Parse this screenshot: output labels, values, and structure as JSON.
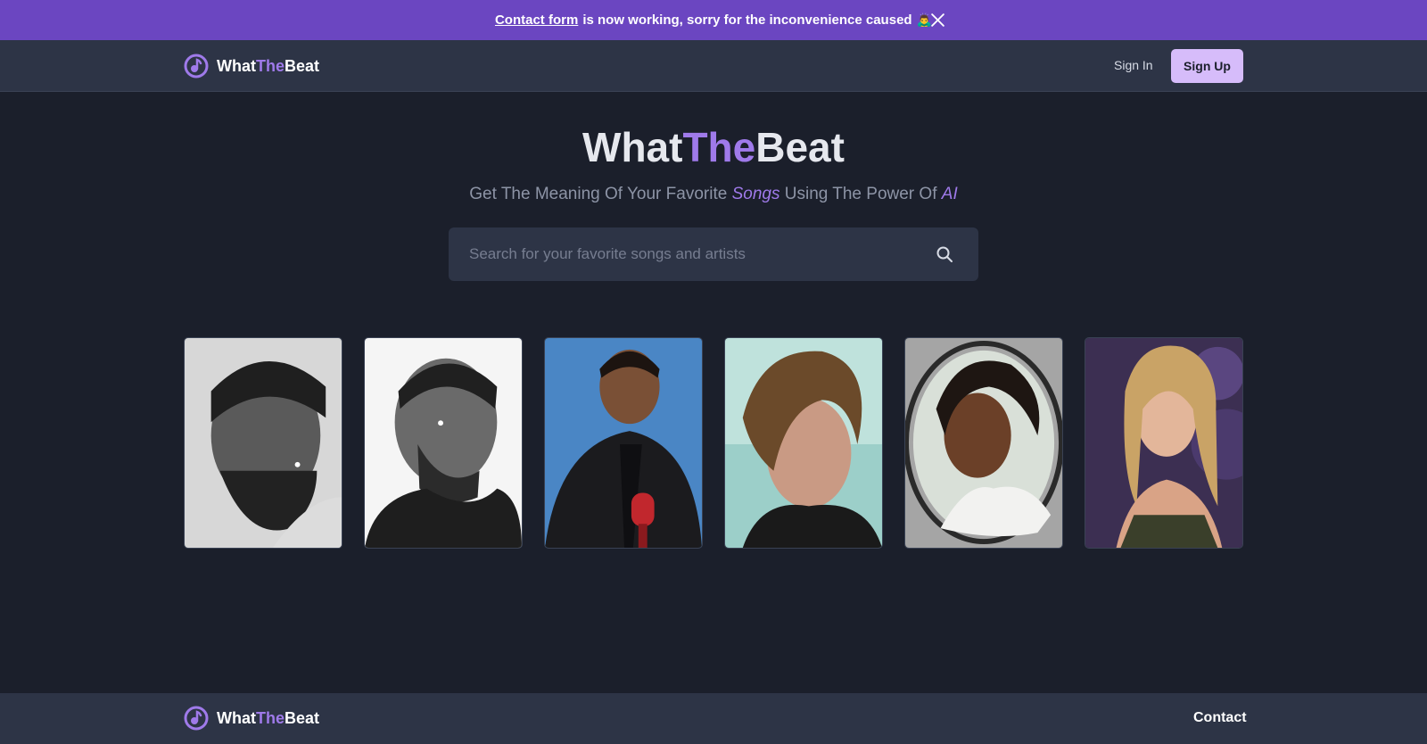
{
  "banner": {
    "link_text": "Contact form",
    "message": "is now working, sorry for the inconvenience caused",
    "emoji": "🙇‍♂️",
    "close_icon": "close-icon"
  },
  "brand": {
    "part1": "What",
    "part2": "The",
    "part3": "Beat",
    "logo_icon": "music-note-logo-icon"
  },
  "header": {
    "signin_label": "Sign In",
    "signup_label": "Sign Up"
  },
  "hero": {
    "title_part1": "What",
    "title_part2": "The",
    "title_part3": "Beat",
    "subtitle_part1": "Get The Meaning Of Your Favorite",
    "subtitle_em1": "Songs",
    "subtitle_part2": "Using The Power Of",
    "subtitle_em2": "AI"
  },
  "search": {
    "placeholder": "Search for your favorite songs and artists",
    "value": "",
    "icon": "search-icon"
  },
  "footer": {
    "contact_label": "Contact"
  },
  "colors": {
    "accent": "#9f7aea",
    "banner": "#6b46c1",
    "signup_bg": "#d6bcfa",
    "background": "#1b1f2b",
    "panel": "#2d3446"
  }
}
